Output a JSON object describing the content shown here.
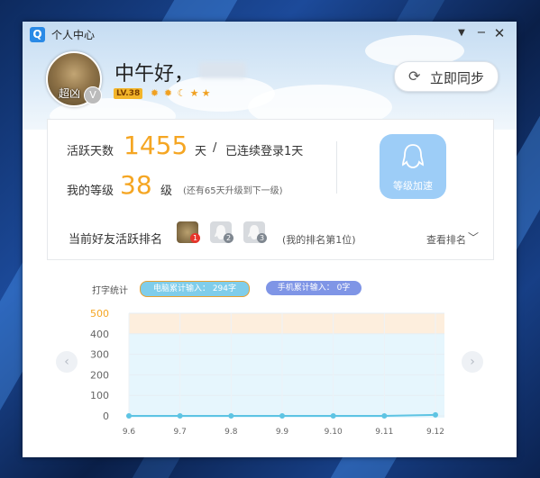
{
  "window": {
    "title": "个人中心"
  },
  "profile": {
    "avatar_text": "超凶",
    "vip_symbol": "V",
    "greeting": "中午好，",
    "level_badge": "LV.38",
    "level_icons": [
      "sun-icon",
      "sun-icon",
      "moon-icon",
      "star-icon",
      "star-icon"
    ]
  },
  "sync": {
    "label": "立即同步"
  },
  "stats": {
    "active_days_label": "活跃天数",
    "active_days_value": "1455",
    "active_days_unit": "天",
    "separator": "/",
    "consecutive": "已连续登录1天",
    "level_label": "我的等级",
    "level_value": "38",
    "level_unit": "级",
    "level_note": "(还有65天升级到下一级)",
    "accelerate_label": "等级加速"
  },
  "ranking": {
    "title": "当前好友活跃排名",
    "friends": [
      {
        "rank": "1",
        "rank_color": "#e8352b"
      },
      {
        "rank": "2",
        "rank_color": "#7f8790"
      },
      {
        "rank": "3",
        "rank_color": "#7f8790"
      }
    ],
    "my_rank": "(我的排名第1位)",
    "view_label": "查看排名"
  },
  "typing": {
    "title": "打字统计",
    "pc_label": "电脑累计输入：  294字",
    "mobile_label": "手机累计输入：  0字"
  },
  "chart_data": {
    "type": "line",
    "categories": [
      "9.6",
      "9.7",
      "9.8",
      "9.9",
      "9.10",
      "9.11",
      "9.12"
    ],
    "series": [
      {
        "values": [
          0,
          0,
          0,
          0,
          0,
          0,
          5
        ]
      }
    ],
    "ylim": [
      0,
      500
    ],
    "yticks": [
      "0",
      "100",
      "200",
      "300",
      "400",
      "500"
    ],
    "colors": {
      "line": "#5ec4e3",
      "band_top": "#fdeedd",
      "band_main": "#e6f6fd",
      "top_tick": "#f5a623"
    }
  }
}
